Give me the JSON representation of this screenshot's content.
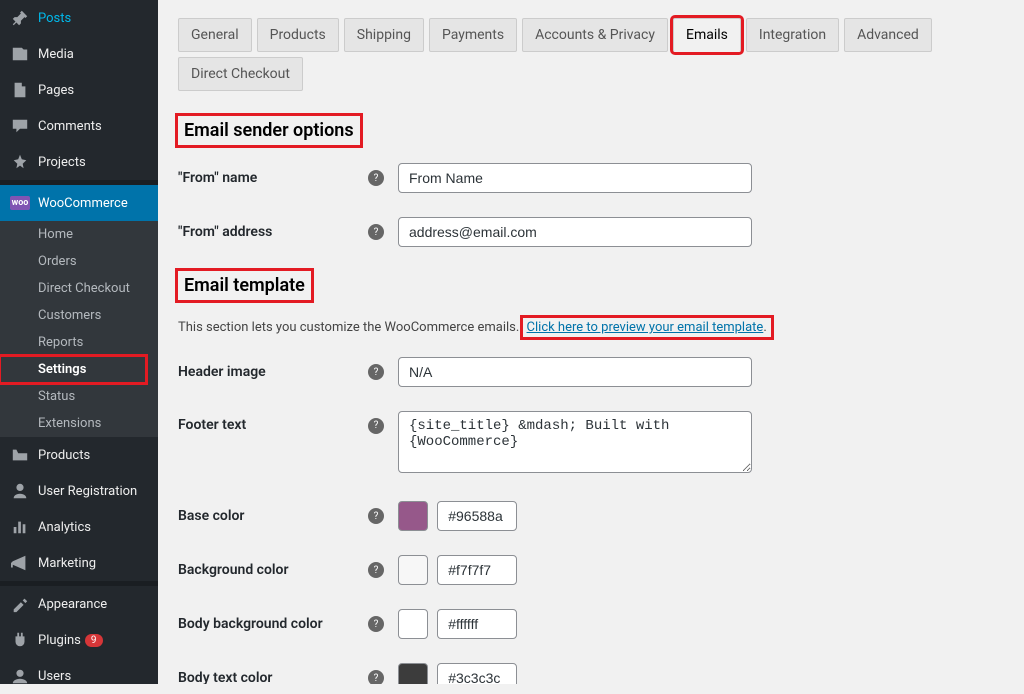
{
  "sidebar": {
    "items": [
      {
        "label": "Posts"
      },
      {
        "label": "Media"
      },
      {
        "label": "Pages"
      },
      {
        "label": "Comments"
      },
      {
        "label": "Projects"
      },
      {
        "label": "WooCommerce"
      },
      {
        "label": "Products"
      },
      {
        "label": "User Registration"
      },
      {
        "label": "Analytics"
      },
      {
        "label": "Marketing"
      },
      {
        "label": "Appearance"
      },
      {
        "label": "Plugins"
      },
      {
        "label": "Users"
      }
    ],
    "woo_sub": [
      {
        "label": "Home"
      },
      {
        "label": "Orders"
      },
      {
        "label": "Direct Checkout"
      },
      {
        "label": "Customers"
      },
      {
        "label": "Reports"
      },
      {
        "label": "Settings"
      },
      {
        "label": "Status"
      },
      {
        "label": "Extensions"
      }
    ],
    "plugins_badge": "9"
  },
  "tabs": [
    {
      "label": "General"
    },
    {
      "label": "Products"
    },
    {
      "label": "Shipping"
    },
    {
      "label": "Payments"
    },
    {
      "label": "Accounts & Privacy"
    },
    {
      "label": "Emails"
    },
    {
      "label": "Integration"
    },
    {
      "label": "Advanced"
    },
    {
      "label": "Direct Checkout"
    }
  ],
  "section1": {
    "heading": "Email sender options",
    "from_name_label": "\"From\" name",
    "from_name_value": "From Name",
    "from_addr_label": "\"From\" address",
    "from_addr_value": "address@email.com"
  },
  "section2": {
    "heading": "Email template",
    "desc_pre": "This section lets you customize the WooCommerce emails. ",
    "desc_link": "Click here to preview your email template",
    "desc_post": ".",
    "header_image_label": "Header image",
    "header_image_value": "N/A",
    "footer_text_label": "Footer text",
    "footer_text_value": "{site_title} &mdash; Built with {WooCommerce}",
    "base_color_label": "Base color",
    "base_color_value": "#96588a",
    "bg_color_label": "Background color",
    "bg_color_value": "#f7f7f7",
    "body_bg_label": "Body background color",
    "body_bg_value": "#ffffff",
    "body_text_label": "Body text color",
    "body_text_value": "#3c3c3c"
  }
}
